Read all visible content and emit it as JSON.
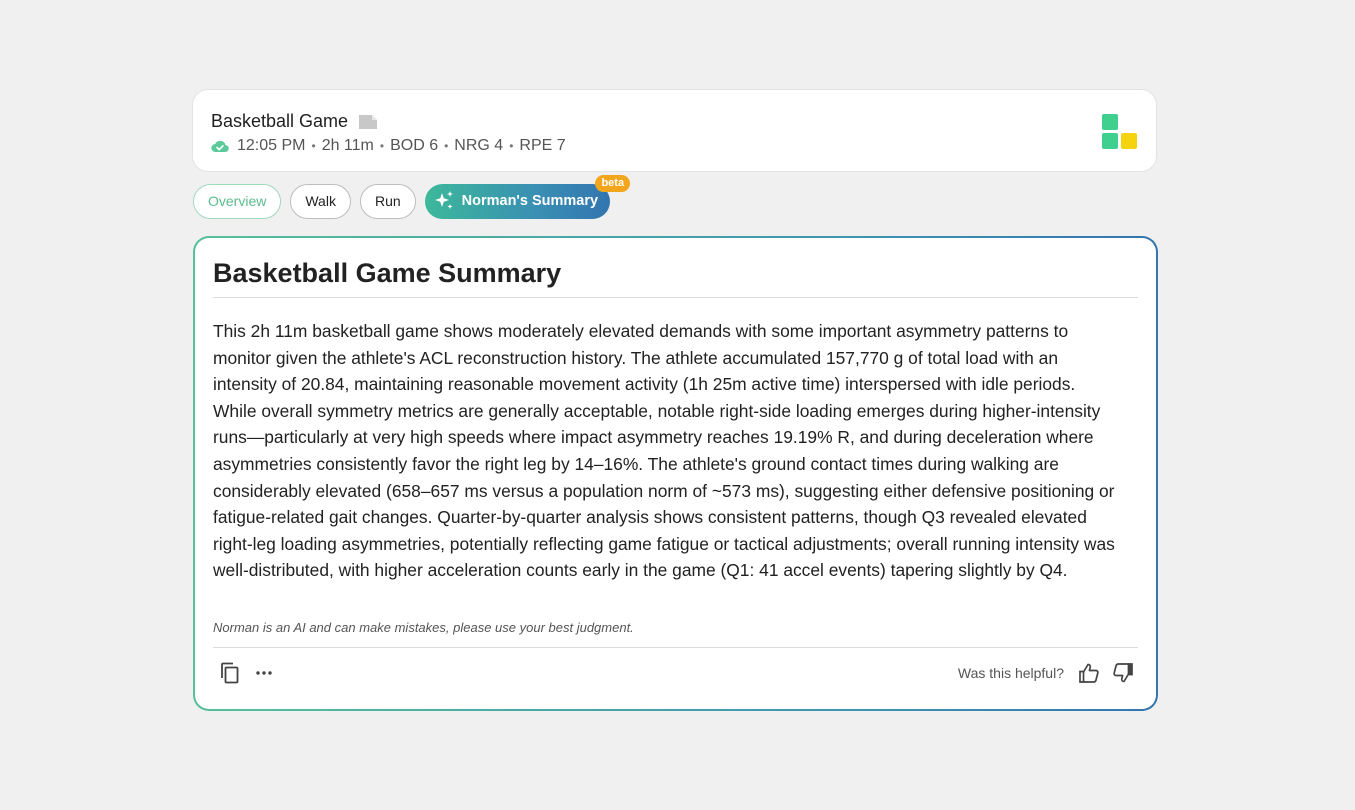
{
  "session": {
    "title": "Basketball Game",
    "meta": [
      "12:05 PM",
      "2h 11m",
      "BOD 6",
      "NRG 4",
      "RPE 7"
    ],
    "separator": "•"
  },
  "tabs": [
    {
      "label": "Overview"
    },
    {
      "label": "Walk"
    },
    {
      "label": "Run"
    },
    {
      "label": "Norman's Summary",
      "badge": "beta"
    }
  ],
  "summary": {
    "title": "Basketball Game Summary",
    "body": "This 2h 11m basketball game shows moderately elevated demands with some important asymmetry patterns to monitor given the athlete's ACL reconstruction history. The athlete accumulated 157,770 g of total load with an intensity of 20.84, maintaining reasonable movement activity (1h 25m active time) interspersed with idle periods. While overall symmetry metrics are generally acceptable, notable right-side loading emerges during higher-intensity runs—particularly at very high speeds where impact asymmetry reaches 19.19% R, and during deceleration where asymmetries consistently favor the right leg by 14–16%. The athlete's ground contact times during walking are considerably elevated (658–657 ms versus a population norm of ~573 ms), suggesting either defensive positioning or fatigue-related gait changes. Quarter-by-quarter analysis shows consistent patterns, though Q3 revealed elevated right-leg loading asymmetries, potentially reflecting game fatigue or tactical adjustments; overall running intensity was well-distributed, with higher acceleration counts early in the game (Q1: 41 accel events) tapering slightly by Q4.",
    "disclaimer": "Norman is an AI and can make mistakes, please use your best judgment.",
    "helpful_label": "Was this helpful?"
  },
  "colors": {
    "accent_green": "#3cb99a",
    "accent_blue": "#3275b0",
    "badge_orange": "#f3a51c",
    "logo_green": "#3fcf8e",
    "logo_yellow": "#f5d40f"
  },
  "icons": {
    "note": "note-icon",
    "cloud": "cloud-check-icon",
    "logo": "brand-logo",
    "sparkle": "sparkle-icon",
    "copy": "copy-icon",
    "more": "more-icon",
    "thumbs_up": "thumbs-up-icon",
    "thumbs_down": "thumbs-down-icon"
  }
}
